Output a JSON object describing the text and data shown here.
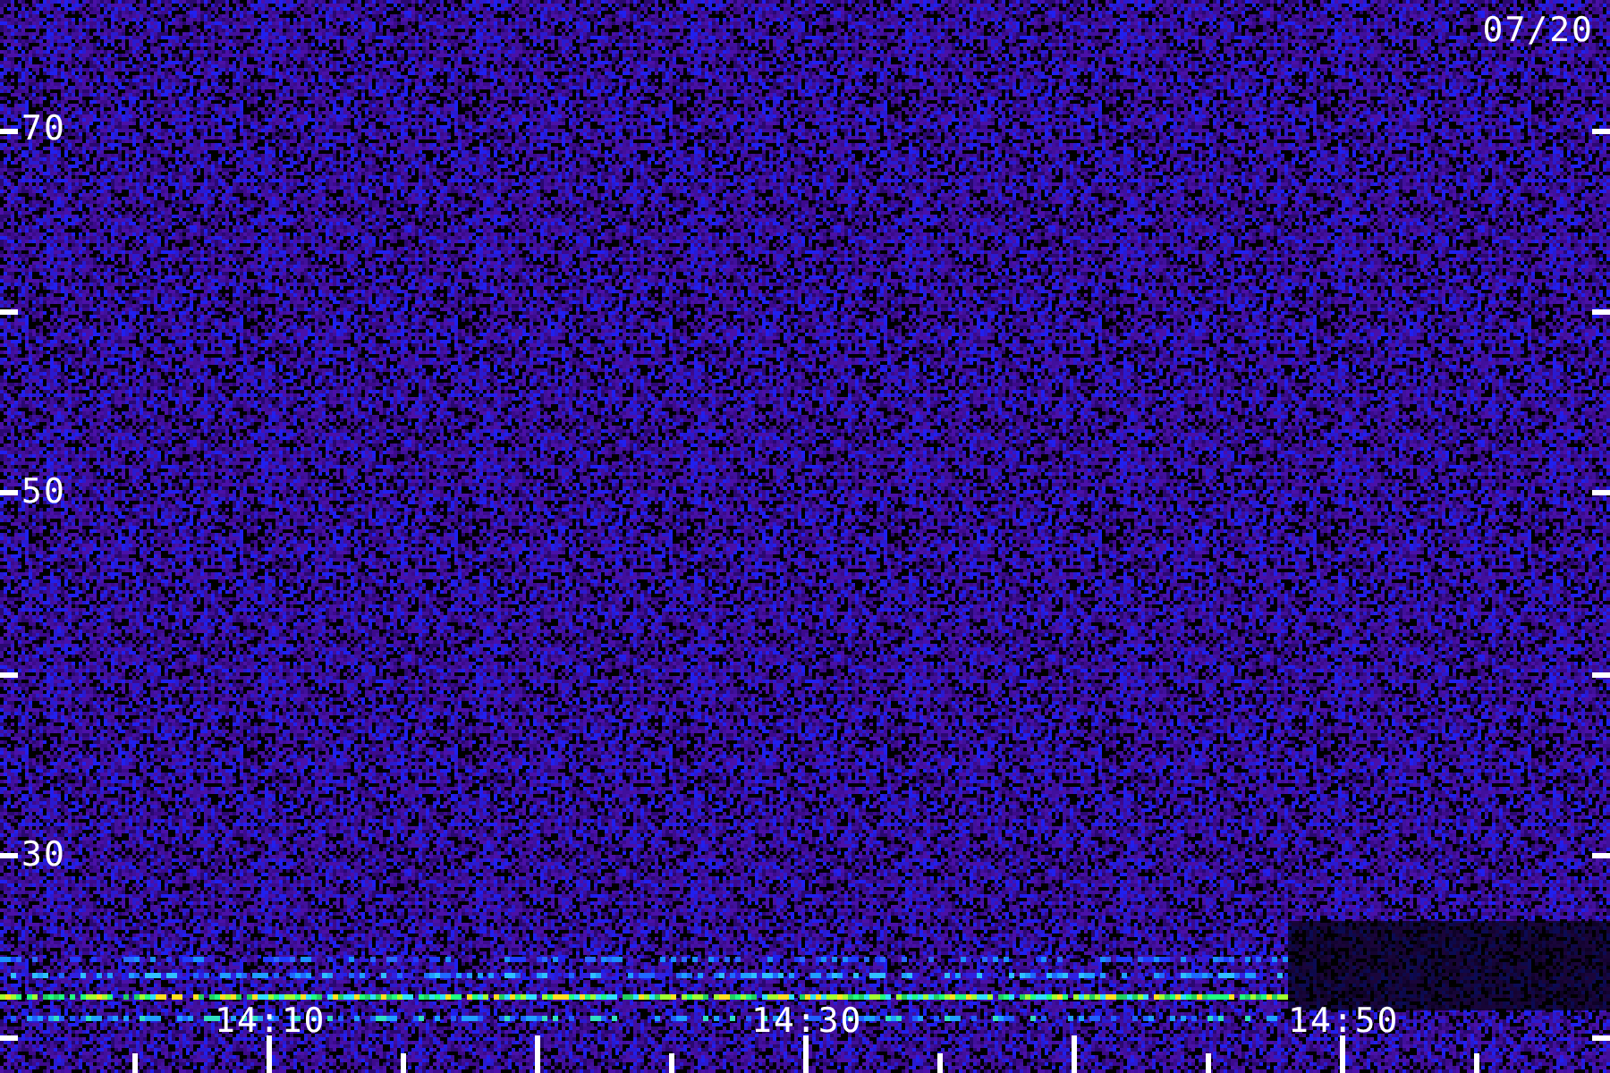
{
  "date": "07/20",
  "y_axis": {
    "labels": [
      "70",
      "50",
      "30"
    ]
  },
  "x_axis": {
    "labels": [
      "14:10",
      "14:30",
      "14:50"
    ]
  }
}
